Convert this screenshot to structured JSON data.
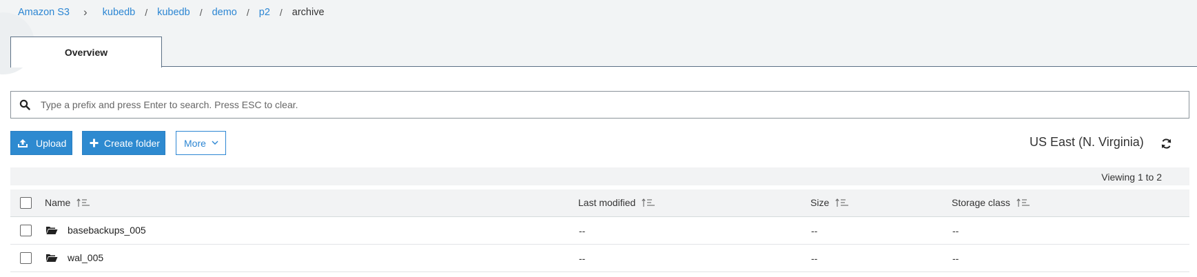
{
  "breadcrumb": {
    "root": "Amazon S3",
    "chevron": "›",
    "separator": "/",
    "items": [
      "kubedb",
      "kubedb",
      "demo",
      "p2"
    ],
    "current": "archive"
  },
  "tabs": [
    {
      "label": "Overview"
    }
  ],
  "search": {
    "placeholder": "Type a prefix and press Enter to search. Press ESC to clear.",
    "value": ""
  },
  "toolbar": {
    "upload_label": "Upload",
    "create_folder_label": "Create folder",
    "more_label": "More",
    "region": "US East (N. Virginia)"
  },
  "viewing": "Viewing 1 to 2",
  "table": {
    "columns": [
      "Name",
      "Last modified",
      "Size",
      "Storage class"
    ],
    "rows": [
      {
        "name": "basebackups_005",
        "last_modified": "--",
        "size": "--",
        "storage_class": "--"
      },
      {
        "name": "wal_005",
        "last_modified": "--",
        "size": "--",
        "storage_class": "--"
      }
    ]
  },
  "colors": {
    "primary": "#2e8ad0",
    "link": "#2c86d3",
    "header_bg": "#f2f4f5"
  }
}
